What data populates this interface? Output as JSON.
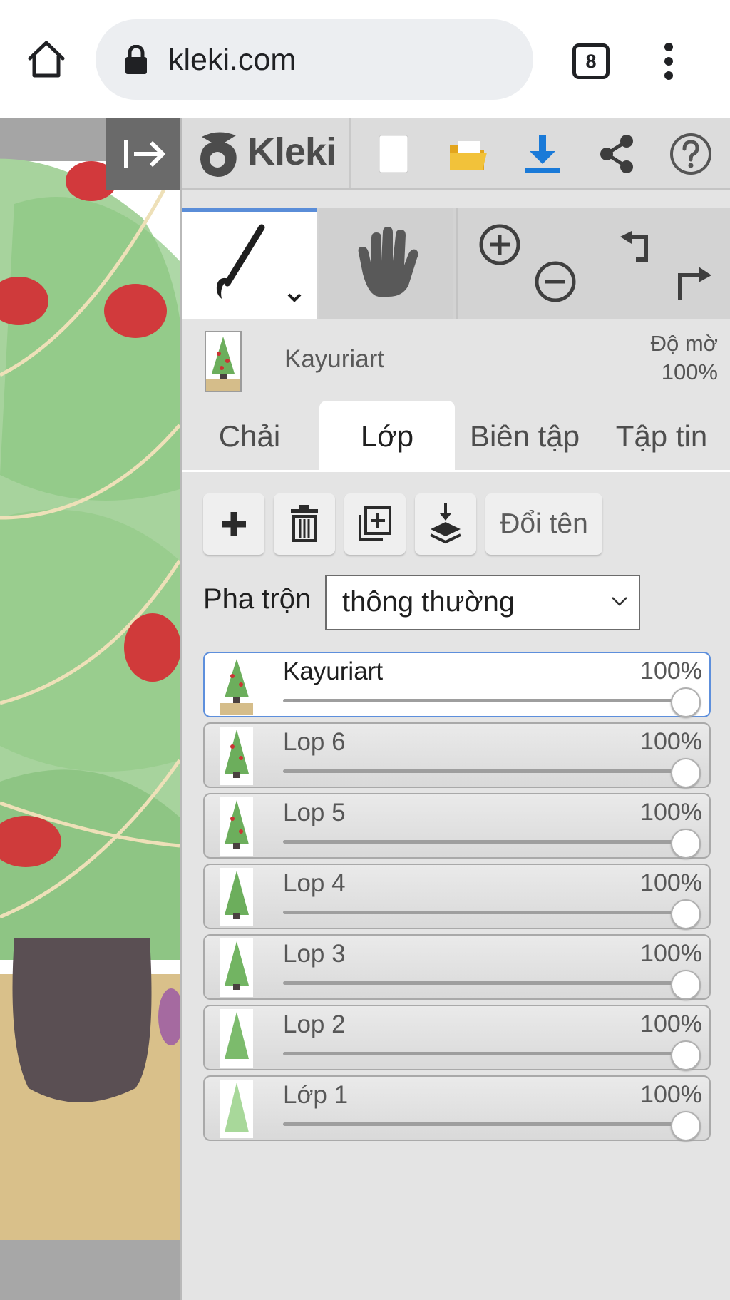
{
  "browser": {
    "url": "kleki.com",
    "tab_count": "8",
    "icons": [
      "home-icon",
      "lock-icon",
      "tabs-icon",
      "more-vert-icon"
    ]
  },
  "app": {
    "logo_text": "Kleki",
    "toolbar_icons": [
      "new-document-icon",
      "open-folder-icon",
      "download-icon",
      "share-icon",
      "help-icon"
    ],
    "tool_icons": [
      "brush-icon",
      "hand-icon",
      "zoom-in-icon",
      "zoom-out-icon",
      "undo-icon",
      "redo-icon"
    ],
    "accent_color": "#5a8dd8"
  },
  "current_layer": {
    "name": "Kayuriart",
    "opacity_label": "Độ mờ",
    "opacity_value": "100%"
  },
  "tabs": [
    {
      "label": "Chải",
      "active": false
    },
    {
      "label": "Lớp",
      "active": true
    },
    {
      "label": "Biên tập",
      "active": false
    },
    {
      "label": "Tập tin",
      "active": false
    }
  ],
  "layer_actions": {
    "icons": [
      "add-layer-icon",
      "delete-layer-icon",
      "duplicate-layer-icon",
      "merge-down-icon"
    ],
    "rename_label": "Đổi tên"
  },
  "blend": {
    "label": "Pha trộn",
    "value": "thông thường"
  },
  "layers": [
    {
      "name": "Kayuriart",
      "opacity": "100%",
      "level": 1.0,
      "selected": true
    },
    {
      "name": "Lop 6",
      "opacity": "100%",
      "level": 1.0,
      "selected": false
    },
    {
      "name": "Lop 5",
      "opacity": "100%",
      "level": 1.0,
      "selected": false
    },
    {
      "name": "Lop 4",
      "opacity": "100%",
      "level": 1.0,
      "selected": false
    },
    {
      "name": "Lop 3",
      "opacity": "100%",
      "level": 1.0,
      "selected": false
    },
    {
      "name": "Lop 2",
      "opacity": "100%",
      "level": 1.0,
      "selected": false
    },
    {
      "name": "Lớp 1",
      "opacity": "100%",
      "level": 1.0,
      "selected": false
    }
  ]
}
